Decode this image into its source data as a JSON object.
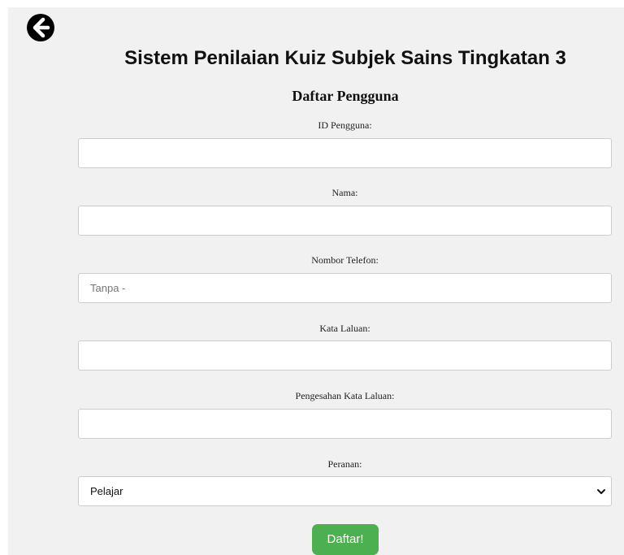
{
  "header": {
    "back_icon": "arrow-circle-left-icon",
    "app_title": "Sistem Penilaian Kuiz Subjek Sains Tingkatan 3"
  },
  "form": {
    "heading": "Daftar Pengguna",
    "fields": [
      {
        "label": "ID Pengguna:",
        "value": "",
        "placeholder": ""
      },
      {
        "label": "Nama:",
        "value": "",
        "placeholder": ""
      },
      {
        "label": "Nombor Telefon:",
        "value": "",
        "placeholder": "Tanpa -"
      },
      {
        "label": "Kata Laluan:",
        "value": "",
        "placeholder": ""
      },
      {
        "label": "Pengesahan Kata Laluan:",
        "value": "",
        "placeholder": ""
      }
    ],
    "role": {
      "label": "Peranan:",
      "selected": "Pelajar"
    },
    "submit_label": "Daftar!"
  },
  "colors": {
    "panel_background": "#f1f1f1",
    "submit_button": "#4caf50",
    "input_border": "#cccccc"
  }
}
